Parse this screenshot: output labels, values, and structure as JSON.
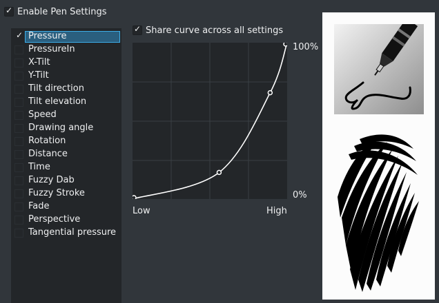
{
  "enable": {
    "label": "Enable Pen Settings",
    "checked": true
  },
  "share": {
    "label": "Share curve across all settings",
    "checked": true
  },
  "sensors": [
    {
      "label": "Pressure",
      "checked": true,
      "selected": true
    },
    {
      "label": "PressureIn",
      "checked": false
    },
    {
      "label": "X-Tilt",
      "checked": false
    },
    {
      "label": "Y-Tilt",
      "checked": false
    },
    {
      "label": "Tilt direction",
      "checked": false
    },
    {
      "label": "Tilt elevation",
      "checked": false
    },
    {
      "label": "Speed",
      "checked": false
    },
    {
      "label": "Drawing angle",
      "checked": false
    },
    {
      "label": "Rotation",
      "checked": false
    },
    {
      "label": "Distance",
      "checked": false
    },
    {
      "label": "Time",
      "checked": false
    },
    {
      "label": "Fuzzy Dab",
      "checked": false
    },
    {
      "label": "Fuzzy Stroke",
      "checked": false
    },
    {
      "label": "Fade",
      "checked": false
    },
    {
      "label": "Perspective",
      "checked": false
    },
    {
      "label": "Tangential pressure",
      "checked": false
    }
  ],
  "curve": {
    "label_max": "100%",
    "label_min": "0%",
    "label_low": "Low",
    "label_high": "High",
    "points": [
      [
        0,
        0
      ],
      [
        0.56,
        0.17
      ],
      [
        0.89,
        0.68
      ],
      [
        1,
        1
      ]
    ]
  },
  "colors": {
    "accent": "#3daee9",
    "selection": "#2a5f7f",
    "background": "#31363b",
    "panel": "#232629"
  },
  "icons": {
    "check": "check-icon",
    "pen_preview": "pen-nib-icon"
  }
}
